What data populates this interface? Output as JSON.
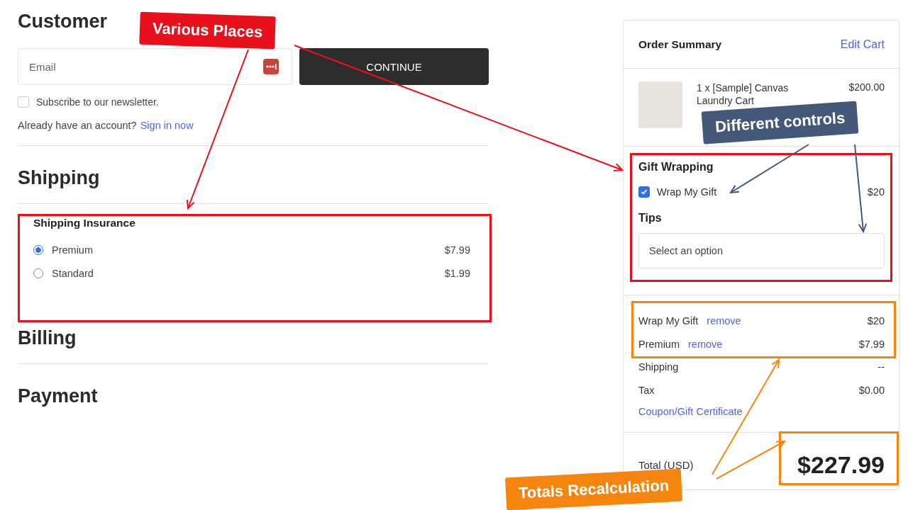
{
  "customer": {
    "title": "Customer",
    "email": {
      "placeholder": "Email"
    },
    "continue_button": "CONTINUE",
    "newsletter": {
      "label": "Subscribe to our newsletter.",
      "checked": false
    },
    "account_prompt": "Already have an account?",
    "sign_in_link": "Sign in now"
  },
  "shipping": {
    "title": "Shipping",
    "insurance": {
      "title": "Shipping Insurance",
      "options": [
        {
          "label": "Premium",
          "price": "$7.99",
          "selected": true
        },
        {
          "label": "Standard",
          "price": "$1.99",
          "selected": false
        }
      ]
    }
  },
  "billing": {
    "title": "Billing"
  },
  "payment": {
    "title": "Payment"
  },
  "summary": {
    "title": "Order Summary",
    "edit_link": "Edit Cart",
    "item": {
      "description": "1 x [Sample] Canvas Laundry Cart",
      "price": "$200.00"
    },
    "gift_wrapping": {
      "title": "Gift Wrapping",
      "option": {
        "label": "Wrap My Gift",
        "price": "$20",
        "checked": true
      }
    },
    "tips": {
      "title": "Tips",
      "placeholder": "Select an option"
    },
    "lines": [
      {
        "kind": "removable",
        "label": "Wrap My Gift",
        "action": "remove",
        "value": "$20"
      },
      {
        "kind": "removable",
        "label": "Premium",
        "action": "remove",
        "value": "$7.99"
      },
      {
        "kind": "plain",
        "label": "Shipping",
        "value": "--"
      },
      {
        "kind": "plain",
        "label": "Tax",
        "value": "$0.00"
      }
    ],
    "coupon_link": "Coupon/Gift Certificate",
    "total": {
      "label": "Total (USD)",
      "amount": "$227.99"
    }
  },
  "annotations": [
    {
      "text": "Various Places",
      "color": "#e8101a"
    },
    {
      "text": "Different controls",
      "color": "#44597a"
    },
    {
      "text": "Totals Recalculation",
      "color": "#f5850f"
    }
  ]
}
